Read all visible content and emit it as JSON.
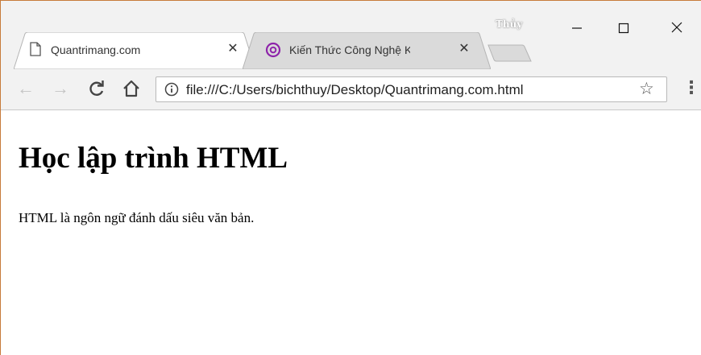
{
  "browser": {
    "profile_name": "Thủy",
    "tabs": [
      {
        "title": "Quantrimang.com",
        "icon": "page-icon",
        "active": true
      },
      {
        "title": "Kiến Thức Công Nghệ Kh",
        "icon": "opera-icon",
        "active": false
      }
    ],
    "window_controls": {
      "minimize": "—",
      "maximize": "☐",
      "close": "✕"
    },
    "url": "file:///C:/Users/bichthuy/Desktop/Quantrimang.com.html"
  },
  "page": {
    "heading": "Học lập trình HTML",
    "paragraph": "HTML là ngôn ngữ đánh dấu siêu văn bản."
  },
  "colors": {
    "window_border": "#c77b3b",
    "chrome_bg": "#f2f2f2",
    "tab_icon_accent": "#8e24aa"
  }
}
